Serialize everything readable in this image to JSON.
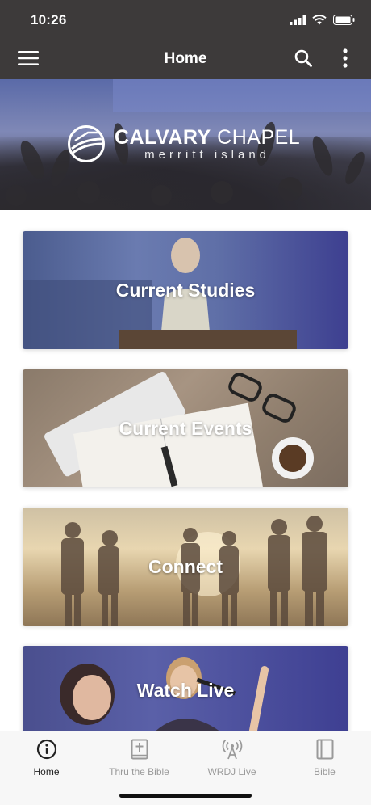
{
  "status": {
    "time": "10:26"
  },
  "header": {
    "title": "Home"
  },
  "hero": {
    "logo_main_bold": "CALVARY",
    "logo_main_light": "CHAPEL",
    "logo_sub": "merritt island"
  },
  "cards": [
    {
      "label": "Current Studies"
    },
    {
      "label": "Current Events"
    },
    {
      "label": "Connect"
    },
    {
      "label": "Watch Live"
    }
  ],
  "tabs": [
    {
      "label": "Home",
      "icon": "info-circle-icon",
      "active": true
    },
    {
      "label": "Thru the Bible",
      "icon": "bible-plus-icon",
      "active": false
    },
    {
      "label": "WRDJ Live",
      "icon": "radio-tower-icon",
      "active": false
    },
    {
      "label": "Bible",
      "icon": "book-icon",
      "active": false
    }
  ],
  "colors": {
    "appbar": "#3d3a3a",
    "tabbar": "#f7f7f7",
    "active_tab": "#222222",
    "inactive_tab": "#9a9a9a"
  }
}
